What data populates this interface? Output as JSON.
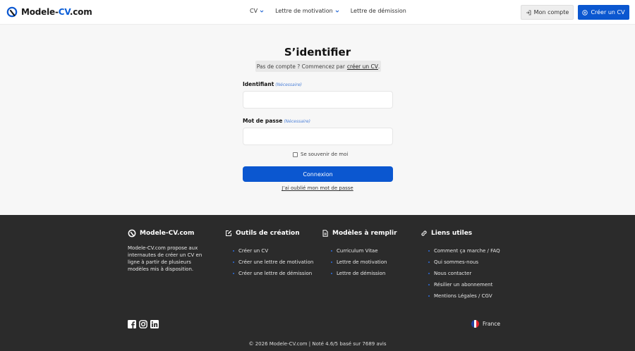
{
  "header": {
    "logo_main": "Modele-",
    "logo_accent": "CV",
    "logo_suffix": ".com",
    "nav": [
      {
        "label": "CV",
        "dropdown": true
      },
      {
        "label": "Lettre de motivation",
        "dropdown": true
      },
      {
        "label": "Lettre de démission",
        "dropdown": false
      }
    ],
    "account_label": "Mon compte",
    "create_label": "Créer un CV"
  },
  "login": {
    "title": "S’identifier",
    "hint_text": "Pas de compte ? Commencez par",
    "hint_link": "créer un CV",
    "hint_end": ".",
    "username_label": "Identifiant",
    "username_required": "(Nécessaire)",
    "username_value": "",
    "password_label": "Mot de passe",
    "password_required": "(Nécessaire)",
    "password_value": "",
    "remember_label": "Se souvenir de moi",
    "submit_label": "Connexion",
    "forgot_label": "J’ai oublié mon mot de passe"
  },
  "footer": {
    "brand": "Modele-CV.com",
    "description": "Modele-CV.com propose aux internautes de créer un CV en ligne à partir de plusieurs modèles mis à disposition.",
    "col_tools": {
      "title": "Outils de création",
      "items": [
        "Créer un CV",
        "Créer une lettre de motivation",
        "Créer une lettre de démission"
      ]
    },
    "col_models": {
      "title": "Modèles à remplir",
      "items": [
        "Curriculum Vitae",
        "Lettre de motivation",
        "Lettre de démission"
      ]
    },
    "col_links": {
      "title": "Liens utiles",
      "items": [
        "Comment ça marche / FAQ",
        "Qui sommes-nous",
        "Nous contacter",
        "Résilier un abonnement",
        "Mentions Légales / CGV"
      ]
    },
    "language": "France",
    "copyright": "© 2026 Modele-CV.com | Noté 4.6/5 basé sur 7689 avis"
  },
  "colors": {
    "accent": "#0b57d0",
    "footer_bg": "#2b2b2b"
  },
  "icons": [
    "logo-mark-icon",
    "chevron-down-icon",
    "login-icon",
    "plus-circle-icon",
    "edit-icon",
    "document-icon",
    "link-icon",
    "facebook-icon",
    "instagram-icon",
    "linkedin-icon",
    "france-flag-icon"
  ]
}
